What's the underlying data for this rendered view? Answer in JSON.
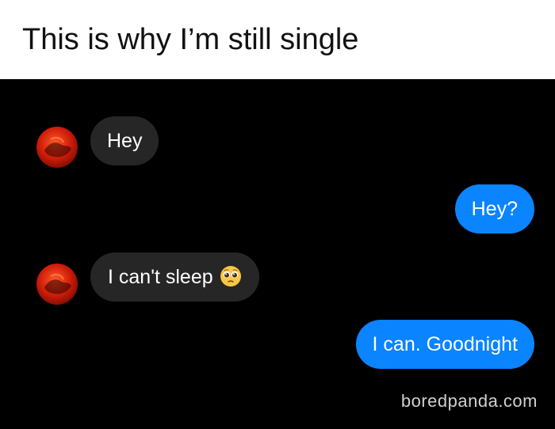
{
  "caption": {
    "title": "This is why I’m still single"
  },
  "conversation": {
    "messages": [
      {
        "side": "incoming",
        "text": "Hey",
        "emoji": ""
      },
      {
        "side": "outgoing",
        "text": "Hey?",
        "emoji": ""
      },
      {
        "side": "incoming",
        "text": "I can't sleep",
        "emoji": "pleading-face"
      },
      {
        "side": "outgoing",
        "text": "I can. Goodnight",
        "emoji": ""
      }
    ]
  },
  "watermark": {
    "text": "boredpanda.com"
  },
  "colors": {
    "background": "#000000",
    "incoming_bubble": "#262626",
    "outgoing_bubble": "#0a84ff",
    "caption_background": "#ffffff"
  }
}
